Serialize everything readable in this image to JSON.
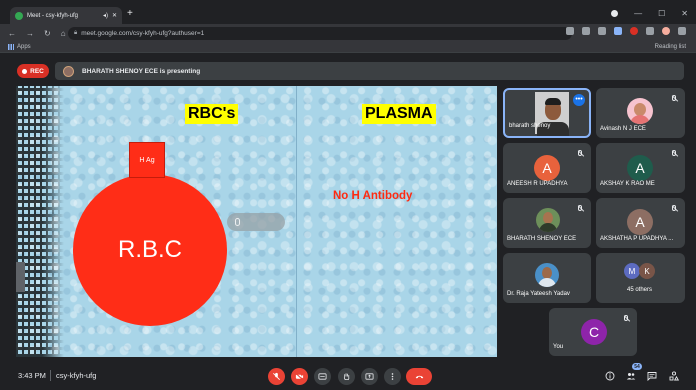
{
  "browser": {
    "tab_title": "Meet - csy-kfyh-ufg",
    "url": "meet.google.com/csy-kfyh-ufg?authuser=1",
    "bookmarks_apps": "Apps",
    "reading_list": "Reading list"
  },
  "meet": {
    "rec_label": "REC",
    "presenting_text": "BHARATH SHENOY ECE is presenting",
    "time": "3:43 PM",
    "meeting_code": "csy-kfyh-ufg",
    "participants_badge": "54"
  },
  "slide": {
    "left_heading": "RBC's",
    "right_heading": "PLASMA",
    "antigen_label": "H Ag",
    "cell_label": "R.B.C",
    "right_text": "No H Antibody"
  },
  "participants": [
    {
      "name": "bharath shenoy",
      "kind": "video"
    },
    {
      "name": "Avinash N J ECE",
      "kind": "photo",
      "muted": true
    },
    {
      "name": "ANEESH R UPADHYA",
      "kind": "letter",
      "letter": "A",
      "color": "#e8623c",
      "muted": true
    },
    {
      "name": "AKSHAY K RAO ME",
      "kind": "letter",
      "letter": "A",
      "color": "#1f5c4c",
      "muted": true
    },
    {
      "name": "BHARATH SHENOY ECE",
      "kind": "photo",
      "muted": true
    },
    {
      "name": "AKSHATHA P UPADHYA ...",
      "kind": "letter",
      "letter": "A",
      "color": "#8d6e63",
      "muted": true
    },
    {
      "name": "Dr. Raja Yateesh Yadav",
      "kind": "photo"
    },
    {
      "name": "45 others",
      "kind": "group",
      "letters": [
        "M",
        "K"
      ],
      "colors": [
        "#5c6bc0",
        "#795548"
      ]
    },
    {
      "name": "You",
      "kind": "letter",
      "letter": "C",
      "color": "#8e24aa",
      "muted": true
    }
  ]
}
